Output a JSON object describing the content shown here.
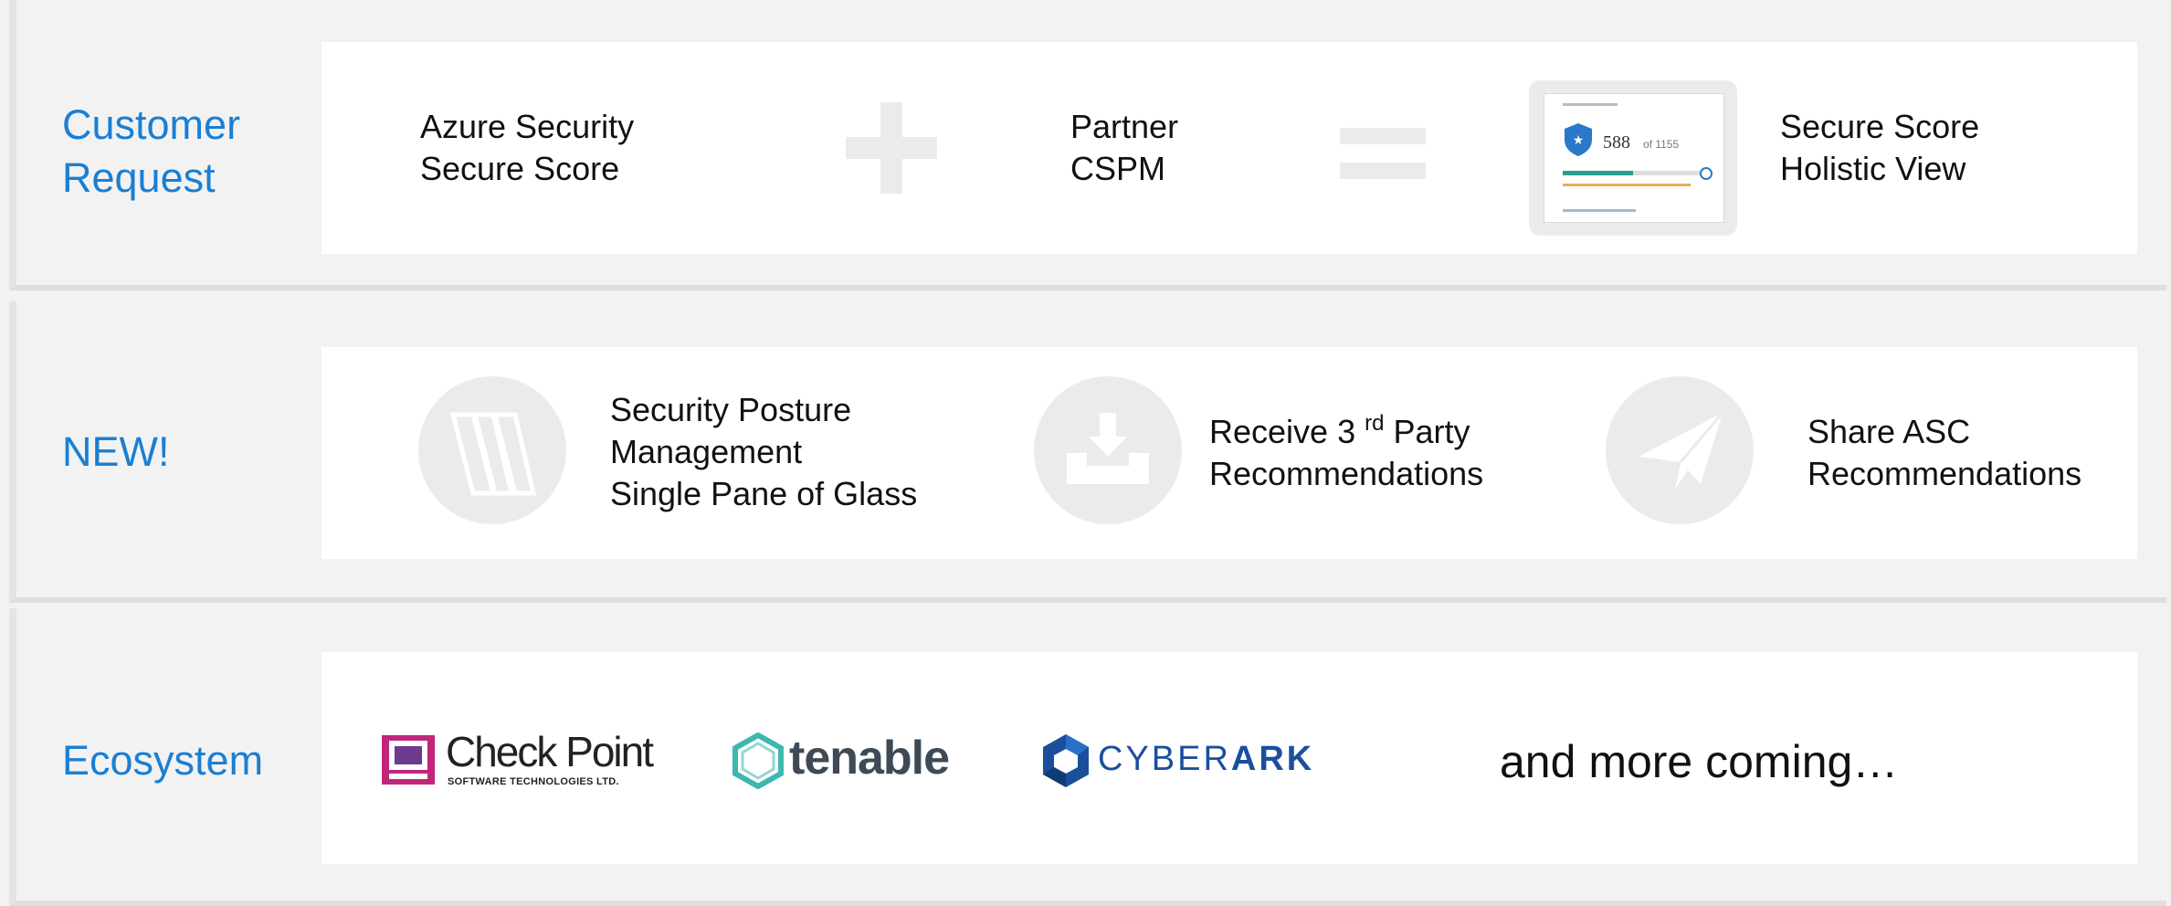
{
  "rows": {
    "customer_request": {
      "label_line1": "Customer",
      "label_line2": "Request",
      "item1_line1": "Azure Security",
      "item1_line2": "Secure Score",
      "item2_line1": "Partner",
      "item2_line2": "CSPM",
      "item3_line1": "Secure Score",
      "item3_line2": "Holistic View",
      "thumb_score": "588",
      "thumb_total": "of 1155"
    },
    "new": {
      "label": "NEW!",
      "item1_line1": "Security Posture",
      "item1_line2": "Management",
      "item1_line3": "Single Pane of Glass",
      "item2_line1_a": "Receive 3",
      "item2_sup": "rd",
      "item2_line1_b": " Party",
      "item2_line2": "Recommendations",
      "item3_line1": "Share ASC",
      "item3_line2": "Recommendations"
    },
    "ecosystem": {
      "label": "Ecosystem",
      "logo1_name": "Check Point",
      "logo1_sub": "SOFTWARE TECHNOLOGIES LTD.",
      "logo2_name": "tenable",
      "logo3_name_a": "CYBER",
      "logo3_name_b": "ARK",
      "more": "and more coming…"
    }
  },
  "colors": {
    "accent_blue": "#1a7fd3",
    "icon_gray": "#ebebeb",
    "checkpoint_pink": "#c0277b",
    "tenable_teal": "#3cb8b0",
    "cyberark_blue": "#1b4f9c"
  },
  "icons": {
    "plus": "plus-icon",
    "equals": "equals-icon",
    "posture": "posture-panes-icon",
    "receive": "inbox-download-icon",
    "share": "paper-plane-icon"
  }
}
